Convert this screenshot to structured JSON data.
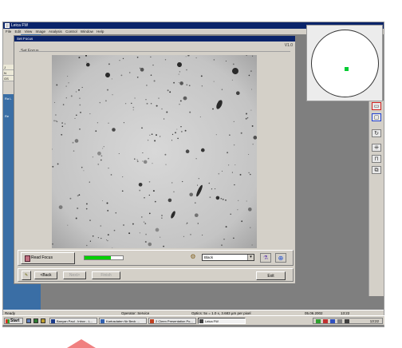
{
  "app": {
    "title": "Leica FW",
    "menu": [
      "File",
      "Edit",
      "View",
      "Image",
      "Analysis",
      "Control",
      "Window",
      "Help"
    ],
    "left_tabs": [
      "J",
      "N",
      "GS"
    ],
    "left_items": [
      "Ra L",
      "Re"
    ]
  },
  "dialog": {
    "title": "Set Focus",
    "version": "V1.0",
    "group_label": "Set Focus",
    "read_focus_label": "Read Focus",
    "focus_level": 0.68,
    "select_value": "Black",
    "back_label": "<Back",
    "next_label": "Next>",
    "finish_label": "Finish",
    "exit_label": "Exit"
  },
  "status": {
    "ready": "Ready",
    "mode": "Operator: Service",
    "optics": "Optics: 5x = 1.0 x, 3.683 µm per pixel",
    "date": "05.06.2002",
    "time": "13:22"
  },
  "taskbar": {
    "start_label": "Start",
    "tasks": [
      {
        "label": "Banyan Paul - Inbox - L...",
        "color": "#1a3a8a"
      },
      {
        "label": "Kartusdaten für Beck ...",
        "color": "#3060b0"
      },
      {
        "label": "2 Cleen Presentation Po...",
        "color": "#c04020"
      },
      {
        "label": "Leica FW",
        "color": "#404040"
      }
    ],
    "clock": "13:22"
  },
  "colors": {
    "titlebar": "#0a246a",
    "desktop_panel": "#3a6ea5",
    "focus_meter": "#00d000",
    "nav_dot": "#00cc33"
  }
}
